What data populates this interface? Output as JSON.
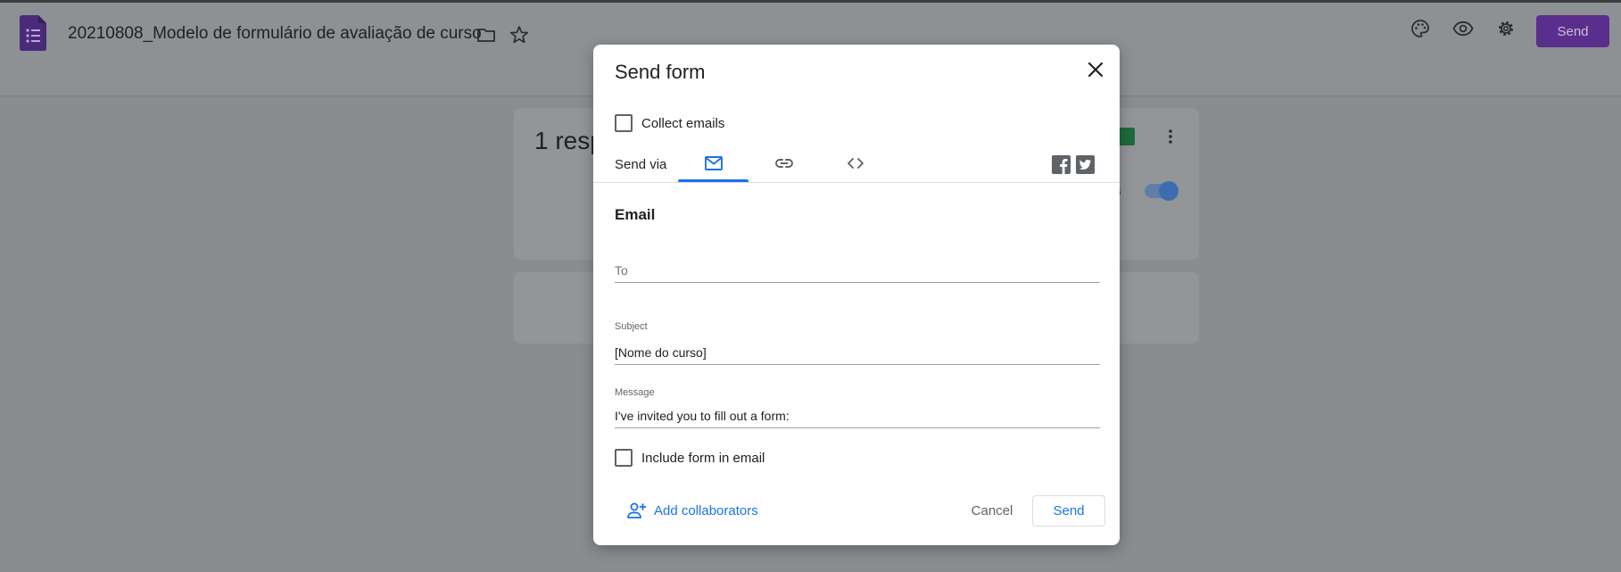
{
  "app": {
    "doc_title": "20210808_Modelo de formulário de avaliação de curso",
    "send_button": "Send",
    "icons": [
      "forms-logo-icon",
      "folder-icon",
      "star-icon",
      "palette-icon",
      "eye-icon",
      "gear-icon"
    ]
  },
  "background": {
    "responses_title": "1 resp",
    "accepting_label": "es"
  },
  "dialog": {
    "title": "Send form",
    "collect_emails_label": "Collect emails",
    "send_via_label": "Send via",
    "tabs": [
      {
        "name": "email",
        "icon": "mail-icon",
        "active": true
      },
      {
        "name": "link",
        "icon": "link-icon",
        "active": false
      },
      {
        "name": "embed",
        "icon": "code-icon",
        "active": false
      }
    ],
    "social": [
      "facebook-icon",
      "twitter-icon"
    ],
    "section_title": "Email",
    "to": {
      "placeholder": "To",
      "value": ""
    },
    "subject": {
      "label": "Subject",
      "value": "[Nome do curso]"
    },
    "message": {
      "label": "Message",
      "value": "I've invited you to fill out a form:"
    },
    "include_form_label": "Include form in email",
    "add_collaborators_label": "Add collaborators",
    "cancel_label": "Cancel",
    "send_label": "Send"
  },
  "colors": {
    "accent": "#1a73e8",
    "brand_purple": "#673ab7",
    "overlay": "#8a8d90"
  }
}
